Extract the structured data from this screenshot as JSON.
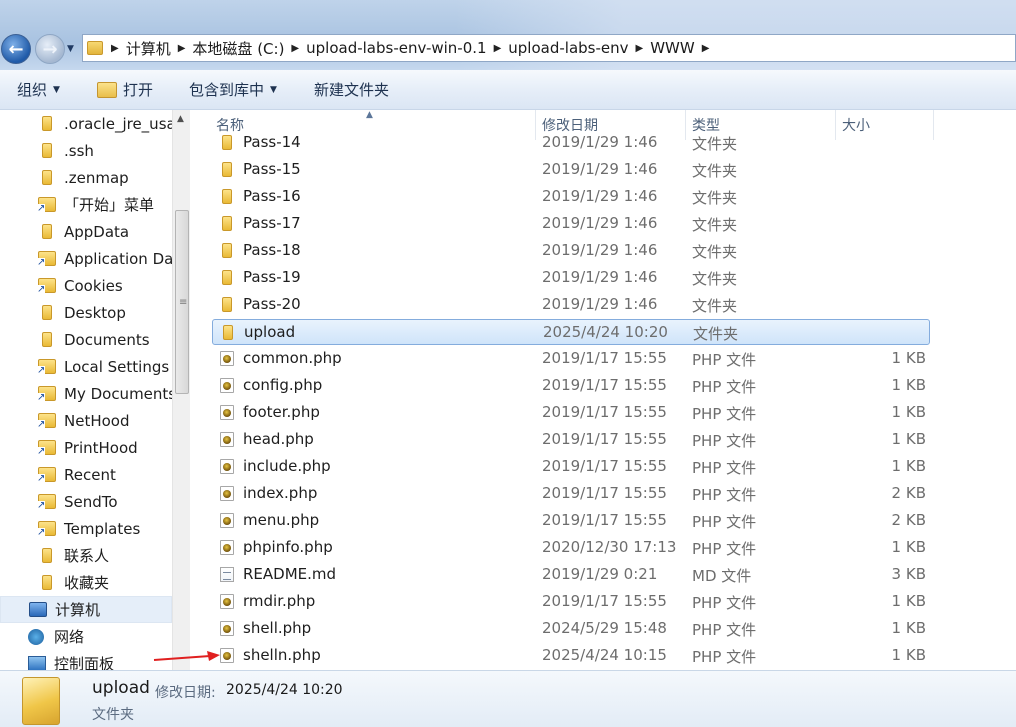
{
  "address_bar": {
    "breadcrumbs": [
      "计算机",
      "本地磁盘 (C:)",
      "upload-labs-env-win-0.1",
      "upload-labs-env",
      "WWW"
    ]
  },
  "toolbar": {
    "organize": "组织",
    "open": "打开",
    "include_in_library": "包含到库中",
    "new_folder": "新建文件夹"
  },
  "nav_pane": {
    "items": [
      {
        "label": ".oracle_jre_usa",
        "icon": "folder-icon"
      },
      {
        "label": ".ssh",
        "icon": "folder-icon"
      },
      {
        "label": ".zenmap",
        "icon": "folder-icon"
      },
      {
        "label": "「开始」菜单",
        "icon": "shortcut-folder-icon"
      },
      {
        "label": "AppData",
        "icon": "folder-icon"
      },
      {
        "label": "Application Da",
        "icon": "shortcut-folder-icon"
      },
      {
        "label": "Cookies",
        "icon": "shortcut-folder-icon"
      },
      {
        "label": "Desktop",
        "icon": "folder-icon"
      },
      {
        "label": "Documents",
        "icon": "folder-icon"
      },
      {
        "label": "Local Settings",
        "icon": "shortcut-folder-icon"
      },
      {
        "label": "My Documents",
        "icon": "shortcut-folder-icon"
      },
      {
        "label": "NetHood",
        "icon": "shortcut-folder-icon"
      },
      {
        "label": "PrintHood",
        "icon": "shortcut-folder-icon"
      },
      {
        "label": "Recent",
        "icon": "shortcut-folder-icon"
      },
      {
        "label": "SendTo",
        "icon": "shortcut-folder-icon"
      },
      {
        "label": "Templates",
        "icon": "shortcut-folder-icon"
      },
      {
        "label": "联系人",
        "icon": "folder-icon"
      },
      {
        "label": "收藏夹",
        "icon": "folder-icon"
      }
    ],
    "computer": "计算机",
    "network": "网络",
    "control_panel": "控制面板"
  },
  "columns": {
    "name": "名称",
    "date": "修改日期",
    "type": "类型",
    "size": "大小"
  },
  "files": [
    {
      "name": "Pass-14",
      "date": "2019/1/29 1:46",
      "type": "文件夹",
      "size": "",
      "kind": "folder"
    },
    {
      "name": "Pass-15",
      "date": "2019/1/29 1:46",
      "type": "文件夹",
      "size": "",
      "kind": "folder"
    },
    {
      "name": "Pass-16",
      "date": "2019/1/29 1:46",
      "type": "文件夹",
      "size": "",
      "kind": "folder"
    },
    {
      "name": "Pass-17",
      "date": "2019/1/29 1:46",
      "type": "文件夹",
      "size": "",
      "kind": "folder"
    },
    {
      "name": "Pass-18",
      "date": "2019/1/29 1:46",
      "type": "文件夹",
      "size": "",
      "kind": "folder"
    },
    {
      "name": "Pass-19",
      "date": "2019/1/29 1:46",
      "type": "文件夹",
      "size": "",
      "kind": "folder"
    },
    {
      "name": "Pass-20",
      "date": "2019/1/29 1:46",
      "type": "文件夹",
      "size": "",
      "kind": "folder"
    },
    {
      "name": "upload",
      "date": "2025/4/24 10:20",
      "type": "文件夹",
      "size": "",
      "kind": "folder",
      "selected": true
    },
    {
      "name": "common.php",
      "date": "2019/1/17 15:55",
      "type": "PHP 文件",
      "size": "1 KB",
      "kind": "php"
    },
    {
      "name": "config.php",
      "date": "2019/1/17 15:55",
      "type": "PHP 文件",
      "size": "1 KB",
      "kind": "php"
    },
    {
      "name": "footer.php",
      "date": "2019/1/17 15:55",
      "type": "PHP 文件",
      "size": "1 KB",
      "kind": "php"
    },
    {
      "name": "head.php",
      "date": "2019/1/17 15:55",
      "type": "PHP 文件",
      "size": "1 KB",
      "kind": "php"
    },
    {
      "name": "include.php",
      "date": "2019/1/17 15:55",
      "type": "PHP 文件",
      "size": "1 KB",
      "kind": "php"
    },
    {
      "name": "index.php",
      "date": "2019/1/17 15:55",
      "type": "PHP 文件",
      "size": "2 KB",
      "kind": "php"
    },
    {
      "name": "menu.php",
      "date": "2019/1/17 15:55",
      "type": "PHP 文件",
      "size": "2 KB",
      "kind": "php"
    },
    {
      "name": "phpinfo.php",
      "date": "2020/12/30 17:13",
      "type": "PHP 文件",
      "size": "1 KB",
      "kind": "php"
    },
    {
      "name": "README.md",
      "date": "2019/1/29 0:21",
      "type": "MD 文件",
      "size": "3 KB",
      "kind": "md"
    },
    {
      "name": "rmdir.php",
      "date": "2019/1/17 15:55",
      "type": "PHP 文件",
      "size": "1 KB",
      "kind": "php"
    },
    {
      "name": "shell.php",
      "date": "2024/5/29 15:48",
      "type": "PHP 文件",
      "size": "1 KB",
      "kind": "php"
    },
    {
      "name": "shelln.php",
      "date": "2025/4/24 10:15",
      "type": "PHP 文件",
      "size": "1 KB",
      "kind": "php"
    }
  ],
  "details": {
    "name": "upload",
    "modified_label": "修改日期:",
    "modified_value": "2025/4/24 10:20",
    "type": "文件夹"
  },
  "colors": {
    "selection_border": "#84acdd",
    "annotation_arrow": "#e02020"
  }
}
